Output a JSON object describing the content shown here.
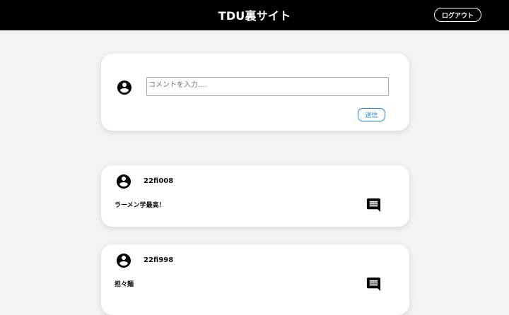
{
  "header": {
    "title": "TDU裏サイト",
    "logout_label": "ログアウト"
  },
  "compose": {
    "avatar_icon": "account-circle-icon",
    "placeholder": "コメントを入力....",
    "send_label": "送信"
  },
  "posts": [
    {
      "user": "22fi008",
      "text": "ラーメン学最高！",
      "icon": "comment-icon"
    },
    {
      "user": "22fi998",
      "text": "担々麺",
      "icon": "comment-icon"
    }
  ],
  "colors": {
    "header_bg": "#000000",
    "page_bg": "#f3f3f3",
    "accent": "#1e88e5"
  }
}
